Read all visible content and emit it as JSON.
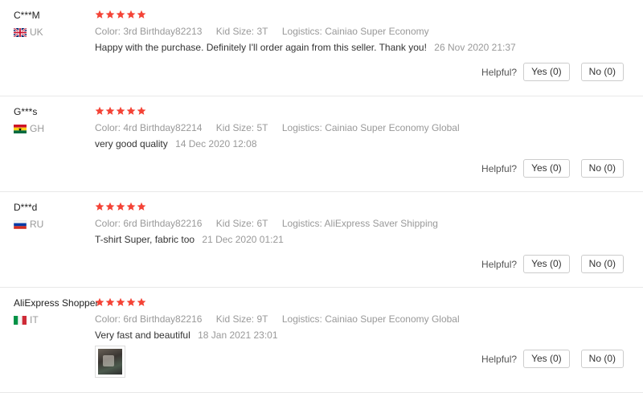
{
  "reviews": [
    {
      "user": "C***M",
      "country": "UK",
      "rating": 5,
      "sku": {
        "color_label": "Color:",
        "color_value": "3rd Birthday82213",
        "size_label": "Kid Size:",
        "size_value": "3T",
        "logistics_label": "Logistics:",
        "logistics_value": "Cainiao Super Economy"
      },
      "text": "Happy with the purchase. Definitely I'll order again from this seller. Thank you!",
      "time": "26 Nov 2020 21:37",
      "helpful_label": "Helpful?",
      "yes_label": "Yes (0)",
      "no_label": "No (0)"
    },
    {
      "user": "G***s",
      "country": "GH",
      "rating": 5,
      "sku": {
        "color_label": "Color:",
        "color_value": "4rd Birthday82214",
        "size_label": "Kid Size:",
        "size_value": "5T",
        "logistics_label": "Logistics:",
        "logistics_value": "Cainiao Super Economy Global"
      },
      "text": "very good quality",
      "time": "14 Dec 2020 12:08",
      "helpful_label": "Helpful?",
      "yes_label": "Yes (0)",
      "no_label": "No (0)"
    },
    {
      "user": "D***d",
      "country": "RU",
      "rating": 5,
      "sku": {
        "color_label": "Color:",
        "color_value": "6rd Birthday82216",
        "size_label": "Kid Size:",
        "size_value": "6T",
        "logistics_label": "Logistics:",
        "logistics_value": "AliExpress Saver Shipping"
      },
      "text": "T-shirt Super, fabric too",
      "time": "21 Dec 2020 01:21",
      "helpful_label": "Helpful?",
      "yes_label": "Yes (0)",
      "no_label": "No (0)"
    },
    {
      "user": "AliExpress Shopper",
      "country": "IT",
      "rating": 5,
      "sku": {
        "color_label": "Color:",
        "color_value": "6rd Birthday82216",
        "size_label": "Kid Size:",
        "size_value": "9T",
        "logistics_label": "Logistics:",
        "logistics_value": "Cainiao Super Economy Global"
      },
      "text": "Very fast and beautiful",
      "time": "18 Jan 2021 23:01",
      "helpful_label": "Helpful?",
      "yes_label": "Yes (0)",
      "no_label": "No (0)"
    }
  ],
  "colors": {
    "star": "#f44336",
    "muted_text": "#999999",
    "body_text": "#333333",
    "border": "#cccccc"
  },
  "icons": {
    "star": "star-icon",
    "flags": [
      "flag-uk-icon",
      "flag-gh-icon",
      "flag-ru-icon",
      "flag-it-icon"
    ]
  }
}
